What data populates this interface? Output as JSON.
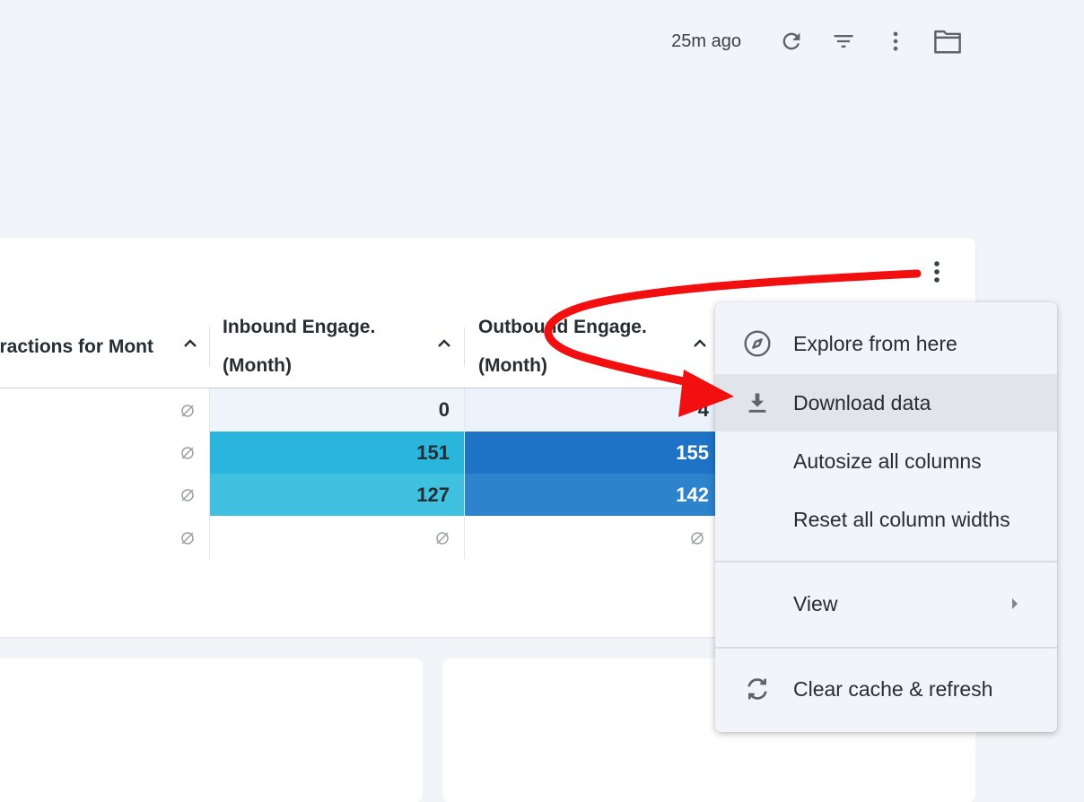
{
  "toolbar": {
    "last_updated": "25m ago",
    "icons": [
      "refresh-icon",
      "filter-icon",
      "more-vert-icon",
      "folder-icon"
    ]
  },
  "table": {
    "columns": [
      {
        "label_line1": "ractions for Mont",
        "label_line2": ""
      },
      {
        "label_line1": "Inbound Engage.",
        "label_line2": "(Month)"
      },
      {
        "label_line1": "Outbound Engage.",
        "label_line2": "(Month)"
      }
    ],
    "rows": [
      {
        "c1": "∅",
        "c2": "0",
        "c3": "4"
      },
      {
        "c1": "∅",
        "c2": "151",
        "c3": "155"
      },
      {
        "c1": "∅",
        "c2": "127",
        "c3": "142"
      },
      {
        "c1": "∅",
        "c2": "∅",
        "c3": "∅"
      }
    ],
    "null_symbol": "∅"
  },
  "menu": {
    "items": [
      {
        "label": "Explore from here",
        "icon": "compass-icon"
      },
      {
        "label": "Download data",
        "icon": "download-icon",
        "highlighted": true
      },
      {
        "label": "Autosize all columns",
        "icon": ""
      },
      {
        "label": "Reset all column widths",
        "icon": ""
      },
      {
        "label": "View",
        "icon": "",
        "submenu": true
      },
      {
        "label": "Clear cache & refresh",
        "icon": "sync-icon"
      }
    ]
  },
  "colors": {
    "page_bg": "#f1f4f8",
    "annotation_red": "#f20f0f",
    "inbound_row2": "#29b5dc",
    "inbound_row3": "#3fc1df",
    "outbound_row2": "#1e73c7",
    "outbound_row3": "#2d83cc"
  }
}
